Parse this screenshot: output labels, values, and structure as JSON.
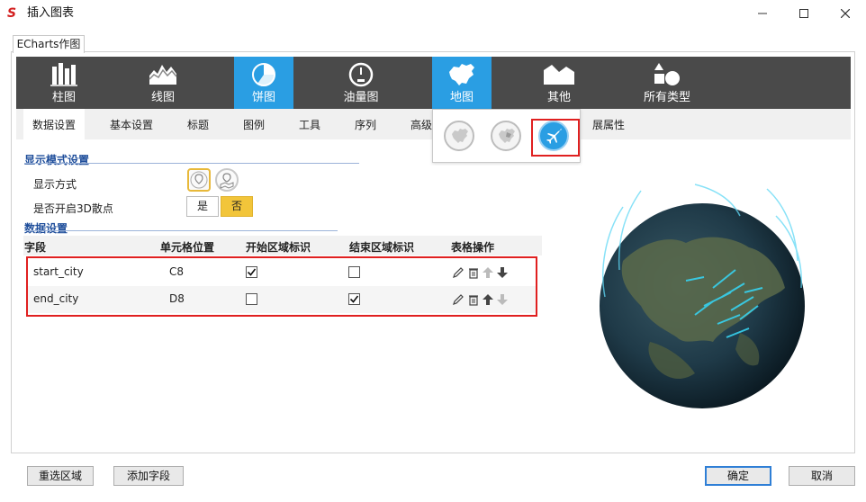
{
  "window": {
    "title": "插入图表",
    "logo": "S",
    "controls": [
      "minimize-icon",
      "maximize-icon",
      "close-icon"
    ]
  },
  "frame_tab": "ECharts作图",
  "chart_types": [
    {
      "label": "柱图",
      "icon": "bar-chart-icon"
    },
    {
      "label": "线图",
      "icon": "line-chart-icon"
    },
    {
      "label": "饼图",
      "icon": "pie-chart-icon",
      "active": true
    },
    {
      "label": "油量图",
      "icon": "gauge-icon"
    },
    {
      "label": "地图",
      "icon": "china-map-icon"
    },
    {
      "label": "其他",
      "icon": "other-chart-icon"
    },
    {
      "label": "所有类型",
      "icon": "all-types-icon"
    }
  ],
  "sub_tabs": [
    "数据设置",
    "基本设置",
    "标题",
    "图例",
    "工具",
    "序列",
    "高级",
    "展属性"
  ],
  "map_popup": {
    "options": [
      "china-map-icon",
      "region-map-icon",
      "airplane-icon"
    ],
    "selected": "airplane-icon"
  },
  "display_section": {
    "title": "显示模式设置",
    "display_mode_label": "显示方式",
    "scatter3d_label": "是否开启3D散点",
    "yes": "是",
    "no": "否",
    "selected": "否"
  },
  "data_section": {
    "title": "数据设置",
    "columns": [
      "字段",
      "单元格位置",
      "开始区域标识",
      "结束区域标识",
      "表格操作"
    ],
    "rows": [
      {
        "field": "start_city",
        "cell": "C8",
        "start": true,
        "end": false
      },
      {
        "field": "end_city",
        "cell": "D8",
        "start": false,
        "end": true
      }
    ]
  },
  "colors": {
    "accent": "#2a9ee3",
    "toolbar": "#4a4a4a",
    "highlight": "#e02020",
    "toggle_on": "#f2c53a",
    "section_title": "#1f4e9b"
  },
  "footer": {
    "reselect": "重选区域",
    "add_field": "添加字段",
    "ok": "确定",
    "cancel": "取消"
  }
}
